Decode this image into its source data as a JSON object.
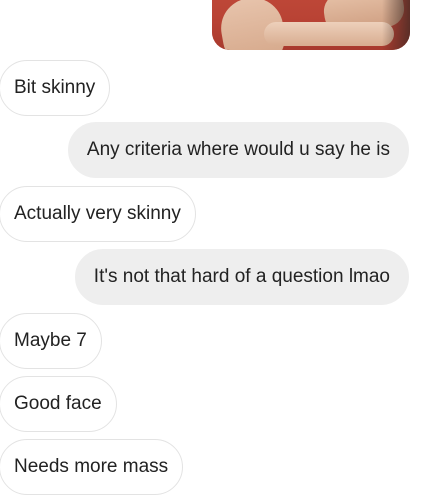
{
  "conversation": {
    "messages": [
      {
        "sender": "other",
        "text": "Bit skinny"
      },
      {
        "sender": "me",
        "text": "Any criteria where would u say he is"
      },
      {
        "sender": "other",
        "text": "Actually very skinny"
      },
      {
        "sender": "me",
        "text": "It's not that hard of a question lmao"
      },
      {
        "sender": "other",
        "text": "Maybe 7"
      },
      {
        "sender": "other",
        "text": "Good face"
      },
      {
        "sender": "other",
        "text": "Needs more mass"
      }
    ]
  },
  "colors": {
    "incoming_bubble": "#ffffff",
    "incoming_border": "#e3e3e3",
    "outgoing_bubble": "#eeeeee",
    "text": "#222222",
    "background": "#ffffff"
  }
}
